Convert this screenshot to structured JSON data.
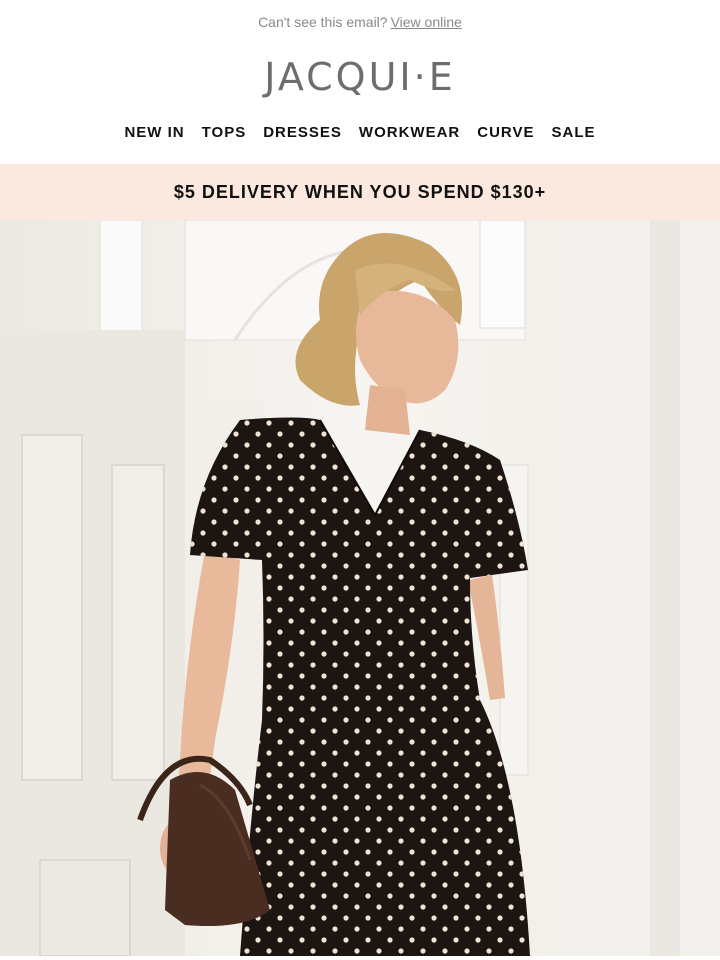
{
  "preheader": {
    "text": "Can't see this email?",
    "link": "View online"
  },
  "brand": {
    "logo_text": "JACQUI·E"
  },
  "nav": {
    "items": [
      "NEW IN",
      "TOPS",
      "DRESSES",
      "WORKWEAR",
      "CURVE",
      "SALE"
    ]
  },
  "promo": {
    "text": "$5 DELIVERY WHEN YOU SPEND $130+"
  },
  "colors": {
    "promo_bg": "#fbe9df",
    "logo": "#6d6d6d",
    "nav_text": "#111111",
    "dress": "#1c1512",
    "dots": "#efe3d2"
  }
}
